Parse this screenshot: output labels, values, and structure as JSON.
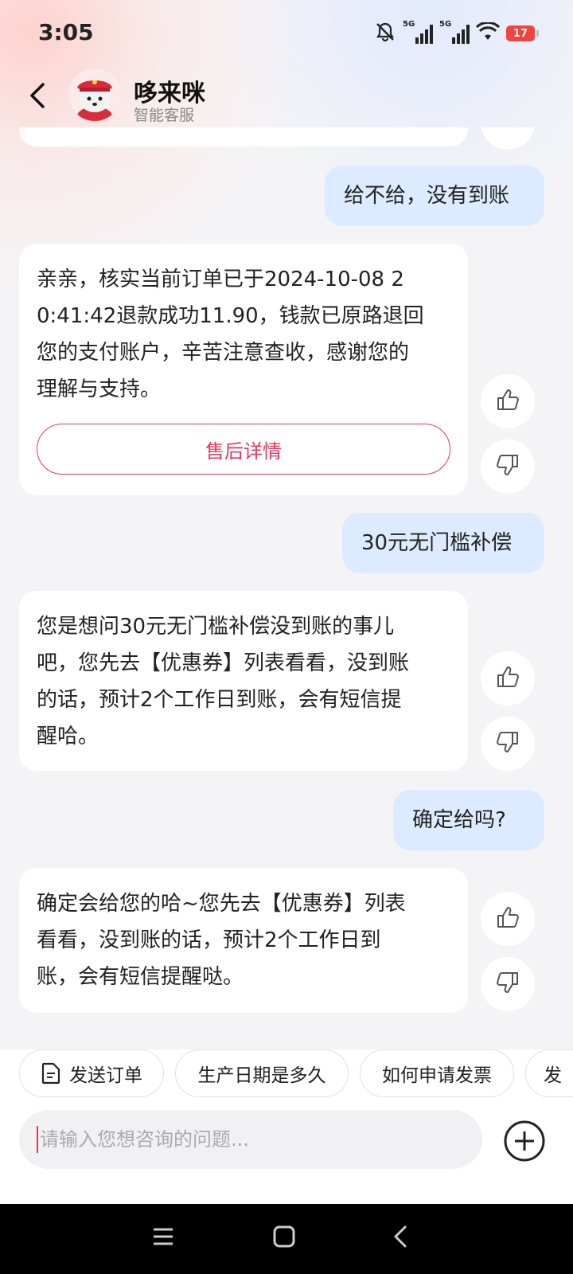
{
  "status_bar": {
    "time": "3:05",
    "battery": "17",
    "network1": "5G",
    "network2": "5G"
  },
  "header": {
    "title": "哆来咪",
    "subtitle": "智能客服"
  },
  "messages": [
    {
      "role": "user",
      "text": "给不给，没有到账"
    },
    {
      "role": "bot",
      "lines": [
        "亲亲，核实当前订单已于2024-10-08 2",
        "0:41:42退款成功11.90，钱款已原路退回",
        "您的支付账户，辛苦注意查收，感谢您的",
        "理解与支持。"
      ],
      "button": "售后详情"
    },
    {
      "role": "user",
      "text": "30元无门槛补偿"
    },
    {
      "role": "bot",
      "lines": [
        "您是想问30元无门槛补偿没到账的事儿",
        "吧，您先去【优惠券】列表看看，没到账",
        "的话，预计2个工作日到账，会有短信提",
        "醒哈。"
      ]
    },
    {
      "role": "user",
      "text": "确定给吗?"
    },
    {
      "role": "bot",
      "lines": [
        "确定会给您的哈~您先去【优惠券】列表",
        "看看，没到账的话，预计2个工作日到",
        "账，会有短信提醒哒。"
      ]
    }
  ],
  "quick_replies": [
    "发送订单",
    "生产日期是多久",
    "如何申请发票",
    "发"
  ],
  "input": {
    "placeholder": "请输入您想咨询的问题..."
  },
  "colors": {
    "accent": "#e8365a",
    "user_bubble": "#dcebff",
    "background": "#f4f4f6"
  }
}
